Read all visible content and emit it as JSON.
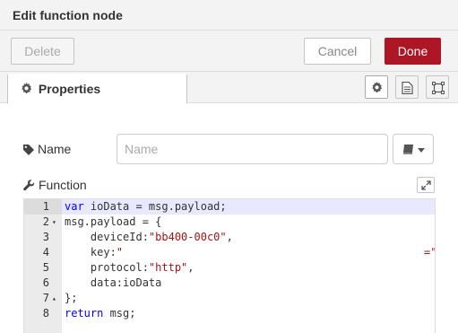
{
  "tray": {
    "title": "Edit function node"
  },
  "toolbar": {
    "delete_label": "Delete",
    "cancel_label": "Cancel",
    "done_label": "Done",
    "done_color": "#ad1625"
  },
  "tabs": {
    "properties_label": "Properties",
    "icons": [
      "gear-icon",
      "description-icon",
      "appearance-icon"
    ]
  },
  "form": {
    "name_label": "Name",
    "name_placeholder": "Name",
    "name_value": "",
    "function_label": "Function"
  },
  "editor": {
    "lines": [
      {
        "n": "1",
        "text": "var ioData = msg.payload;"
      },
      {
        "n": "2",
        "text": "msg.payload = {"
      },
      {
        "n": "3",
        "text": "    deviceId:\"bb400-00c0\","
      },
      {
        "n": "4",
        "text": "    key:\""
      },
      {
        "n": "5",
        "text": "    protocol:\"http\","
      },
      {
        "n": "6",
        "text": "    data:ioData"
      },
      {
        "n": "7",
        "text": "};"
      },
      {
        "n": "8",
        "text": "return msg;"
      }
    ],
    "line4_tail": "=\""
  }
}
